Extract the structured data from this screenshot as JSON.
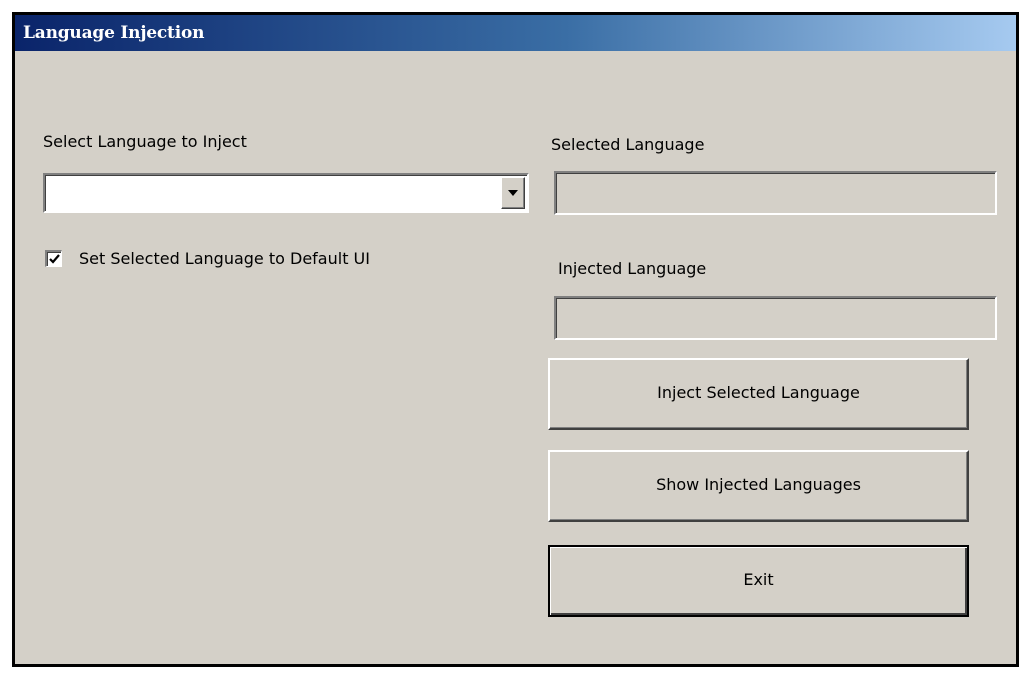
{
  "window": {
    "title": "Language Injection"
  },
  "select_language": {
    "label": "Select Language to Inject",
    "value": "",
    "dropdown_icon": "chevron-down-icon"
  },
  "default_ui_checkbox": {
    "label": "Set Selected Language to Default UI",
    "checked": true
  },
  "selected_language": {
    "label": "Selected Language",
    "value": ""
  },
  "injected_language": {
    "label": "Injected Language",
    "value": ""
  },
  "buttons": {
    "inject": "Inject Selected Language",
    "show": "Show Injected Languages",
    "exit": "Exit"
  },
  "colors": {
    "window_background": "#d4d0c8",
    "titlebar_start": "#0a246a",
    "titlebar_end": "#a6caf0",
    "title_text": "#ffffff"
  }
}
